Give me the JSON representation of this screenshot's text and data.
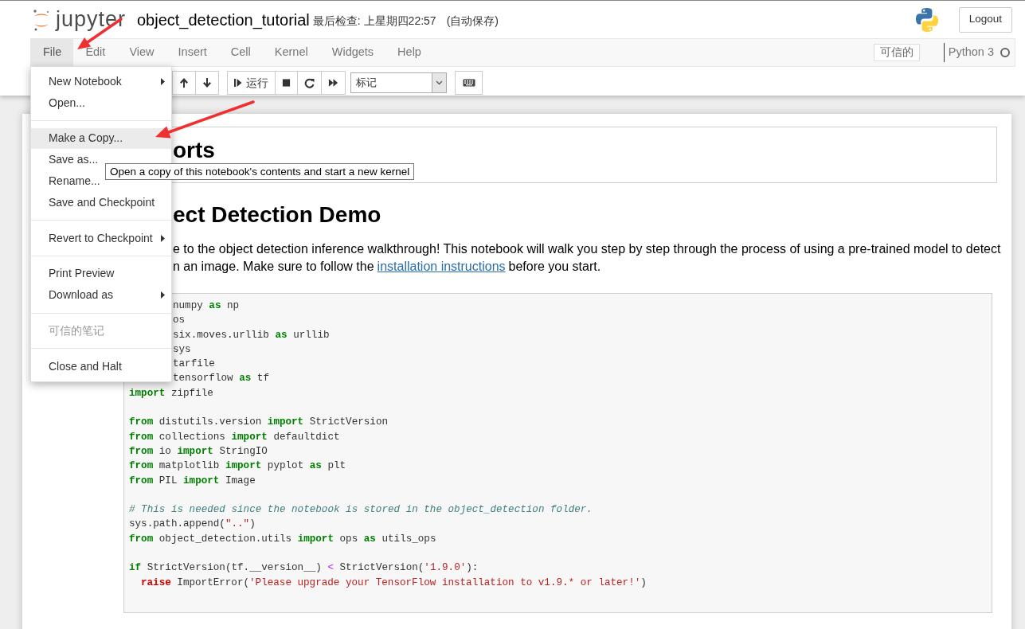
{
  "header": {
    "logo_text": "jupyter",
    "title": "object_detection_tutorial",
    "checkpoint": "最后检查: 上星期四22:57",
    "autosave": "(自动保存)",
    "logout": "Logout"
  },
  "menubar": {
    "items": [
      {
        "label": "File",
        "selected": true
      },
      {
        "label": "Edit",
        "selected": false
      },
      {
        "label": "View",
        "selected": false
      },
      {
        "label": "Insert",
        "selected": false
      },
      {
        "label": "Cell",
        "selected": false
      },
      {
        "label": "Kernel",
        "selected": false
      },
      {
        "label": "Widgets",
        "selected": false
      },
      {
        "label": "Help",
        "selected": false
      }
    ],
    "trusted": "可信的",
    "kernel": "Python 3",
    "kernel_busy": false
  },
  "toolbar": {
    "run_label": "运行",
    "cell_type": "标记"
  },
  "file_menu": [
    {
      "kind": "item",
      "label": "New Notebook",
      "submenu": true,
      "disabled": false,
      "selected": false
    },
    {
      "kind": "item",
      "label": "Open...",
      "submenu": false,
      "disabled": false,
      "selected": false
    },
    {
      "kind": "divider"
    },
    {
      "kind": "item",
      "label": "Make a Copy...",
      "submenu": false,
      "disabled": false,
      "selected": true
    },
    {
      "kind": "item",
      "label": "Save as...",
      "submenu": false,
      "disabled": false,
      "selected": false
    },
    {
      "kind": "item",
      "label": "Rename...",
      "submenu": false,
      "disabled": false,
      "selected": false
    },
    {
      "kind": "item",
      "label": "Save and Checkpoint",
      "submenu": false,
      "disabled": false,
      "selected": false
    },
    {
      "kind": "divider"
    },
    {
      "kind": "item",
      "label": "Revert to Checkpoint",
      "submenu": true,
      "disabled": false,
      "selected": false
    },
    {
      "kind": "divider"
    },
    {
      "kind": "item",
      "label": "Print Preview",
      "submenu": false,
      "disabled": false,
      "selected": false
    },
    {
      "kind": "item",
      "label": "Download as",
      "submenu": true,
      "disabled": false,
      "selected": false
    },
    {
      "kind": "divider"
    },
    {
      "kind": "item",
      "label": "可信的笔记",
      "submenu": false,
      "disabled": true,
      "selected": false
    },
    {
      "kind": "divider"
    },
    {
      "kind": "item",
      "label": "Close and Halt",
      "submenu": false,
      "disabled": false,
      "selected": false
    }
  ],
  "tooltip": "Open a copy of this notebook's contents and start a new kernel",
  "cells": {
    "imports_heading": "orts",
    "demo_heading": "ect Detection Demo",
    "paragraph_line_1": "e to the object detection inference walkthrough! This notebook will walk you step by step through the process of using a pre-trained model to detect",
    "paragraph_line_2": "n an image. Make sure to follow the",
    "link": "installation instructions",
    "paragraph_end": "before you start.",
    "code_blocks": [
      [
        {
          "kind": "clipped",
          "tokens": [
            {
              "kind": "plain",
              "text": "numpy "
            },
            {
              "kind": "keyword",
              "text": "as"
            },
            {
              "kind": "plain",
              "text": " np"
            }
          ]
        },
        {
          "kind": "clipped",
          "tokens": [
            {
              "kind": "plain",
              "text": "os"
            }
          ]
        },
        {
          "kind": "clipped",
          "tokens": [
            {
              "kind": "plain",
              "text": "six.moves.urllib "
            },
            {
              "kind": "keyword",
              "text": "as"
            },
            {
              "kind": "plain",
              "text": " urllib"
            }
          ]
        },
        {
          "kind": "clipped",
          "tokens": [
            {
              "kind": "plain",
              "text": "sys"
            }
          ]
        },
        {
          "kind": "clipped",
          "tokens": [
            {
              "kind": "plain",
              "text": "tarfile"
            }
          ]
        },
        {
          "kind": "clipped",
          "tokens": [
            {
              "kind": "plain",
              "text": "tensorflow "
            },
            {
              "kind": "keyword",
              "text": "as"
            },
            {
              "kind": "plain",
              "text": " tf"
            }
          ]
        },
        {
          "kind": "normal",
          "tokens": [
            {
              "kind": "keyword",
              "text": "import"
            },
            {
              "kind": "plain",
              "text": " zipfile"
            }
          ]
        }
      ],
      [
        {
          "kind": "normal",
          "tokens": [
            {
              "kind": "keyword",
              "text": "from"
            },
            {
              "kind": "plain",
              "text": " distutils.version "
            },
            {
              "kind": "keyword",
              "text": "import"
            },
            {
              "kind": "plain",
              "text": " StrictVersion"
            }
          ]
        },
        {
          "kind": "normal",
          "tokens": [
            {
              "kind": "keyword",
              "text": "from"
            },
            {
              "kind": "plain",
              "text": " collections "
            },
            {
              "kind": "keyword",
              "text": "import"
            },
            {
              "kind": "plain",
              "text": " defaultdict"
            }
          ]
        },
        {
          "kind": "normal",
          "tokens": [
            {
              "kind": "keyword",
              "text": "from"
            },
            {
              "kind": "plain",
              "text": " io "
            },
            {
              "kind": "keyword",
              "text": "import"
            },
            {
              "kind": "plain",
              "text": " StringIO"
            }
          ]
        },
        {
          "kind": "normal",
          "tokens": [
            {
              "kind": "keyword",
              "text": "from"
            },
            {
              "kind": "plain",
              "text": " matplotlib "
            },
            {
              "kind": "keyword",
              "text": "import"
            },
            {
              "kind": "plain",
              "text": " pyplot "
            },
            {
              "kind": "keyword",
              "text": "as"
            },
            {
              "kind": "plain",
              "text": " plt"
            }
          ]
        },
        {
          "kind": "normal",
          "tokens": [
            {
              "kind": "keyword",
              "text": "from"
            },
            {
              "kind": "plain",
              "text": " PIL "
            },
            {
              "kind": "keyword",
              "text": "import"
            },
            {
              "kind": "plain",
              "text": " Image"
            }
          ]
        }
      ],
      [
        {
          "kind": "normal",
          "tokens": [
            {
              "kind": "comment",
              "text": "# This is needed since the notebook is stored in the object_detection folder."
            }
          ]
        },
        {
          "kind": "normal",
          "tokens": [
            {
              "kind": "plain",
              "text": "sys.path.append("
            },
            {
              "kind": "string",
              "text": "\"..\""
            },
            {
              "kind": "plain",
              "text": ")"
            }
          ]
        },
        {
          "kind": "normal",
          "tokens": [
            {
              "kind": "keyword",
              "text": "from"
            },
            {
              "kind": "plain",
              "text": " object_detection.utils "
            },
            {
              "kind": "keyword",
              "text": "import"
            },
            {
              "kind": "plain",
              "text": " ops "
            },
            {
              "kind": "keyword",
              "text": "as"
            },
            {
              "kind": "plain",
              "text": " utils_ops"
            }
          ]
        }
      ],
      [
        {
          "kind": "normal",
          "tokens": [
            {
              "kind": "keyword",
              "text": "if"
            },
            {
              "kind": "plain",
              "text": " StrictVersion(tf.__version__) "
            },
            {
              "kind": "operator",
              "text": "<"
            },
            {
              "kind": "plain",
              "text": " StrictVersion("
            },
            {
              "kind": "string",
              "text": "'1.9.0'"
            },
            {
              "kind": "plain",
              "text": "):"
            }
          ]
        },
        {
          "kind": "indented",
          "tokens": [
            {
              "kind": "exception",
              "text": "raise"
            },
            {
              "kind": "plain",
              "text": " ImportError("
            },
            {
              "kind": "string",
              "text": "'Please upgrade your TensorFlow installation to v1.9.* or later!'"
            },
            {
              "kind": "plain",
              "text": ")"
            }
          ]
        }
      ]
    ]
  }
}
